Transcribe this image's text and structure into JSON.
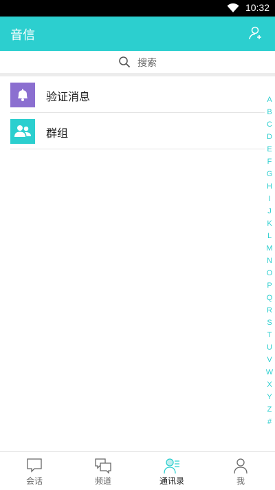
{
  "status_bar": {
    "time": "10:32"
  },
  "app_bar": {
    "title": "音信"
  },
  "search": {
    "placeholder": "搜索"
  },
  "contacts": [
    {
      "label": "验证消息",
      "icon": "bell-icon",
      "color": "#8b6fd0"
    },
    {
      "label": "群组",
      "icon": "group-icon",
      "color": "#2ccfcf"
    }
  ],
  "index_letters": [
    "A",
    "B",
    "C",
    "D",
    "E",
    "F",
    "G",
    "H",
    "I",
    "J",
    "K",
    "L",
    "M",
    "N",
    "O",
    "P",
    "Q",
    "R",
    "S",
    "T",
    "U",
    "V",
    "W",
    "X",
    "Y",
    "Z",
    "#"
  ],
  "tabs": [
    {
      "label": "会话",
      "icon": "chat-icon"
    },
    {
      "label": "频道",
      "icon": "channels-icon"
    },
    {
      "label": "通讯录",
      "icon": "contacts-icon",
      "active": true
    },
    {
      "label": "我",
      "icon": "profile-icon"
    }
  ],
  "colors": {
    "accent": "#2ccfcf",
    "verify": "#8b6fd0"
  }
}
